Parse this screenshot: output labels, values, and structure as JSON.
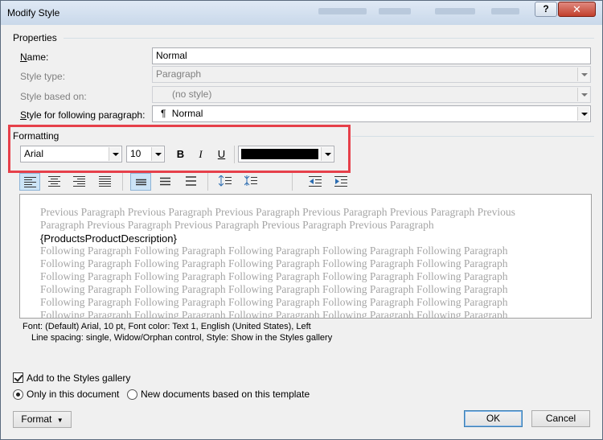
{
  "window": {
    "title": "Modify Style"
  },
  "properties": {
    "group_title": "Properties",
    "name_label": "Name:",
    "name_value": "Normal",
    "style_type_label": "Style type:",
    "style_type_value": "Paragraph",
    "based_on_label": "Style based on:",
    "based_on_value": "(no style)",
    "following_label": "Style for following paragraph:",
    "following_value": "Normal",
    "following_mark": "¶"
  },
  "formatting": {
    "group_title": "Formatting",
    "font": "Arial",
    "size": "10",
    "bold_label": "B",
    "italic_label": "I",
    "underline_label": "U",
    "font_color": "#000000"
  },
  "preview": {
    "previous_text": "Previous Paragraph Previous Paragraph Previous Paragraph Previous Paragraph Previous Paragraph Previous Paragraph Previous Paragraph Previous Paragraph Previous Paragraph Previous Paragraph",
    "sample_text": "{ProductsProductDescription}",
    "following_lines": [
      "Following Paragraph Following Paragraph Following Paragraph Following Paragraph Following Paragraph",
      "Following Paragraph Following Paragraph Following Paragraph Following Paragraph Following Paragraph",
      "Following Paragraph Following Paragraph Following Paragraph Following Paragraph Following Paragraph",
      "Following Paragraph Following Paragraph Following Paragraph Following Paragraph Following Paragraph",
      "Following Paragraph Following Paragraph Following Paragraph Following Paragraph Following Paragraph",
      "Following Paragraph Following Paragraph Following Paragraph Following Paragraph Following Paragraph"
    ]
  },
  "description": {
    "line1": "Font: (Default) Arial, 10 pt, Font color: Text 1, English (United States), Left",
    "line2": "Line spacing:  single, Widow/Orphan control, Style: Show in the Styles gallery"
  },
  "options": {
    "add_to_gallery": "Add to the Styles gallery",
    "only_this_doc": "Only in this document",
    "new_docs": "New documents based on this template"
  },
  "buttons": {
    "format": "Format",
    "ok": "OK",
    "cancel": "Cancel"
  }
}
